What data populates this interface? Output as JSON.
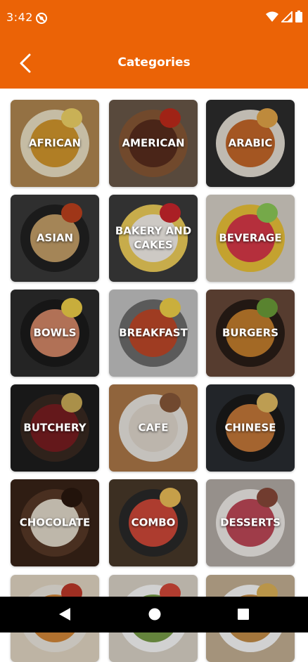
{
  "status_bar": {
    "time": "3:42"
  },
  "app_bar": {
    "title": "Categories"
  },
  "categories": [
    {
      "label": "AFRICAN",
      "bg": "#b58a52",
      "plate": "#f1e6c9",
      "food": "#d79a2e",
      "accent": "#f6d86a"
    },
    {
      "label": "AMERICAN",
      "bg": "#6c5a4a",
      "plate": "#8a5a36",
      "food": "#5b2e1e",
      "accent": "#c42b1c"
    },
    {
      "label": "ARABIC",
      "bg": "#2e2e2e",
      "plate": "#e9e3d8",
      "food": "#c86a2a",
      "accent": "#e8a94a"
    },
    {
      "label": "ASIAN",
      "bg": "#3a3a3a",
      "plate": "#222222",
      "food": "#c9a36b",
      "accent": "#c2431e"
    },
    {
      "label": "BAKERY AND CAKES",
      "bg": "#3c3c3c",
      "plate": "#f3d25c",
      "food": "#fbf6f0",
      "accent": "#d0262e"
    },
    {
      "label": "BEVERAGE",
      "bg": "#dcd6cc",
      "plate": "#f0c63a",
      "food": "#dd3a4a",
      "accent": "#8fcf5a"
    },
    {
      "label": "BOWLS",
      "bg": "#2c2c2c",
      "plate": "#1c1c1c",
      "food": "#d88a6a",
      "accent": "#f4d34a"
    },
    {
      "label": "BREAKFAST",
      "bg": "#c8c8c8",
      "plate": "#6e6e6e",
      "food": "#c24a2a",
      "accent": "#f7d64a"
    },
    {
      "label": "BURGERS",
      "bg": "#6a4a3a",
      "plate": "#2a1e18",
      "food": "#c7802e",
      "accent": "#6da03a"
    },
    {
      "label": "BUTCHERY",
      "bg": "#1e1e1e",
      "plate": "#3a2a22",
      "food": "#7a1e22",
      "accent": "#d0b05a"
    },
    {
      "label": "CAFE",
      "bg": "#b07a4a",
      "plate": "#f0ece6",
      "food": "#e6ddd2",
      "accent": "#8a5a3a"
    },
    {
      "label": "CHINESE",
      "bg": "#2a2e33",
      "plate": "#1a1a1a",
      "food": "#c97a3a",
      "accent": "#e7c064"
    },
    {
      "label": "CHOCOLATE",
      "bg": "#3a2418",
      "plate": "#5a3a28",
      "food": "#e8e0d0",
      "accent": "#2a180e"
    },
    {
      "label": "COMBO",
      "bg": "#4a3a2a",
      "plate": "#2a2a2a",
      "food": "#d44a3a",
      "accent": "#f2c25a"
    },
    {
      "label": "DESSERTS",
      "bg": "#b8b0aa",
      "plate": "#f6f2ee",
      "food": "#c24a5a",
      "accent": "#8a4a3a"
    },
    {
      "label": "",
      "bg": "#e8dcc8",
      "plate": "#f2ede4",
      "food": "#d88a3a",
      "accent": "#c23a2a"
    },
    {
      "label": "",
      "bg": "#e0d8cc",
      "plate": "#ffffff",
      "food": "#7aa04a",
      "accent": "#d84a3a"
    },
    {
      "label": "",
      "bg": "#c8b496",
      "plate": "#ffffff",
      "food": "#c9914a",
      "accent": "#e2b65a"
    }
  ],
  "colors": {
    "primary": "#eb6306",
    "nav_bar": "#000000"
  }
}
